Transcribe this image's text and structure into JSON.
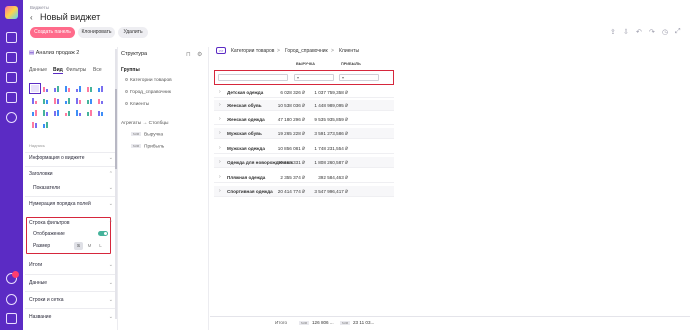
{
  "app": {
    "breadcrumb": "Виджеты",
    "back_glyph": "‹",
    "title": "Новый виджет"
  },
  "actions": {
    "create_panel": "Создать панель",
    "clone": "Клонировать",
    "delete": "Удалить"
  },
  "settings": {
    "widget_name": "Анализ продаж 2",
    "tabs": [
      "Данные",
      "Вид",
      "Фильтры",
      "Все"
    ],
    "active_tab": "Вид",
    "subheading": "Надпись",
    "sections": {
      "widget_info": "Информация о виджете",
      "headers": "Заголовки",
      "indicators": "Показатели",
      "numbering": "Нумерация порядка полей",
      "filter_row": "Строка фильтров",
      "display": "Отображение",
      "size": "Размер",
      "totals": "Итоги",
      "data": "Данные",
      "rows_grid": "Строки и сетка",
      "name": "Название"
    },
    "size_options": [
      "S",
      "M",
      "L"
    ],
    "selected_size": "S",
    "display_enabled": true
  },
  "structure": {
    "title": "Структура",
    "groups_label": "Группы",
    "groups": [
      "Категории товаров",
      "Город_справочник",
      "Клиенты"
    ],
    "aggregates_label": "Агрегаты → Столбцы",
    "sum_badge": "SUM",
    "measures": [
      "Выручка",
      "Прибыль"
    ]
  },
  "table": {
    "expand_glyph": ">>",
    "breadcrumb": [
      "Категории товаров",
      "Город_справочник",
      "Клиенты"
    ],
    "breadcrumb_sep": ">",
    "columns": [
      "ВЫРУЧКА",
      "ПРИБЫЛЬ"
    ],
    "filter_placeholder": "▾",
    "rows": [
      {
        "category": "Детская одежда",
        "revenue": "6 028 326 ₽",
        "profit": "1 037 759,358 ₽"
      },
      {
        "category": "Женская обувь",
        "revenue": "10 538 036 ₽",
        "profit": "1 448 989,095 ₽"
      },
      {
        "category": "Женская одежда",
        "revenue": "47 180 296 ₽",
        "profit": "9 535 935,859 ₽"
      },
      {
        "category": "Мужская обувь",
        "revenue": "19 265 228 ₽",
        "profit": "3 591 273,586 ₽"
      },
      {
        "category": "Мужская одежда",
        "revenue": "10 856 081 ₽",
        "profit": "1 748 231,554 ₽"
      },
      {
        "category": "Одежда для новорожденных",
        "revenue": "10 168 331 ₽",
        "profit": "1 808 260,587 ₽"
      },
      {
        "category": "Пляжная одежда",
        "revenue": "2 355 374 ₽",
        "profit": "392 584,463 ₽"
      },
      {
        "category": "Спортивная одежда",
        "revenue": "20 414 774 ₽",
        "profit": "3 547 996,417 ₽"
      }
    ],
    "total_label": "Итого",
    "total_revenue": "126 806 ...",
    "total_profit": "23 11 03..."
  }
}
